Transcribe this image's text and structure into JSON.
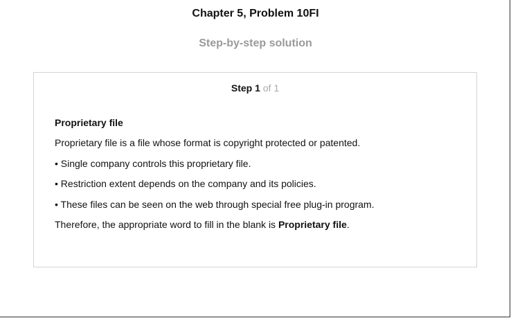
{
  "header": {
    "title": "Chapter 5, Problem 10FI",
    "subtitle": "Step-by-step solution"
  },
  "step": {
    "label": "Step 1",
    "total": "of 1"
  },
  "solution": {
    "heading": "Proprietary file",
    "definition": "Proprietary file is a file whose format is copyright protected or patented.",
    "bullets": [
      "• Single company controls this proprietary file.",
      "• Restriction extent depends on the company and its policies.",
      "• These files can be seen on the web through special free plug-in program."
    ],
    "conclusion_prefix": "Therefore, the appropriate word to fill in the blank is ",
    "conclusion_answer": "Proprietary file",
    "conclusion_suffix": "."
  }
}
